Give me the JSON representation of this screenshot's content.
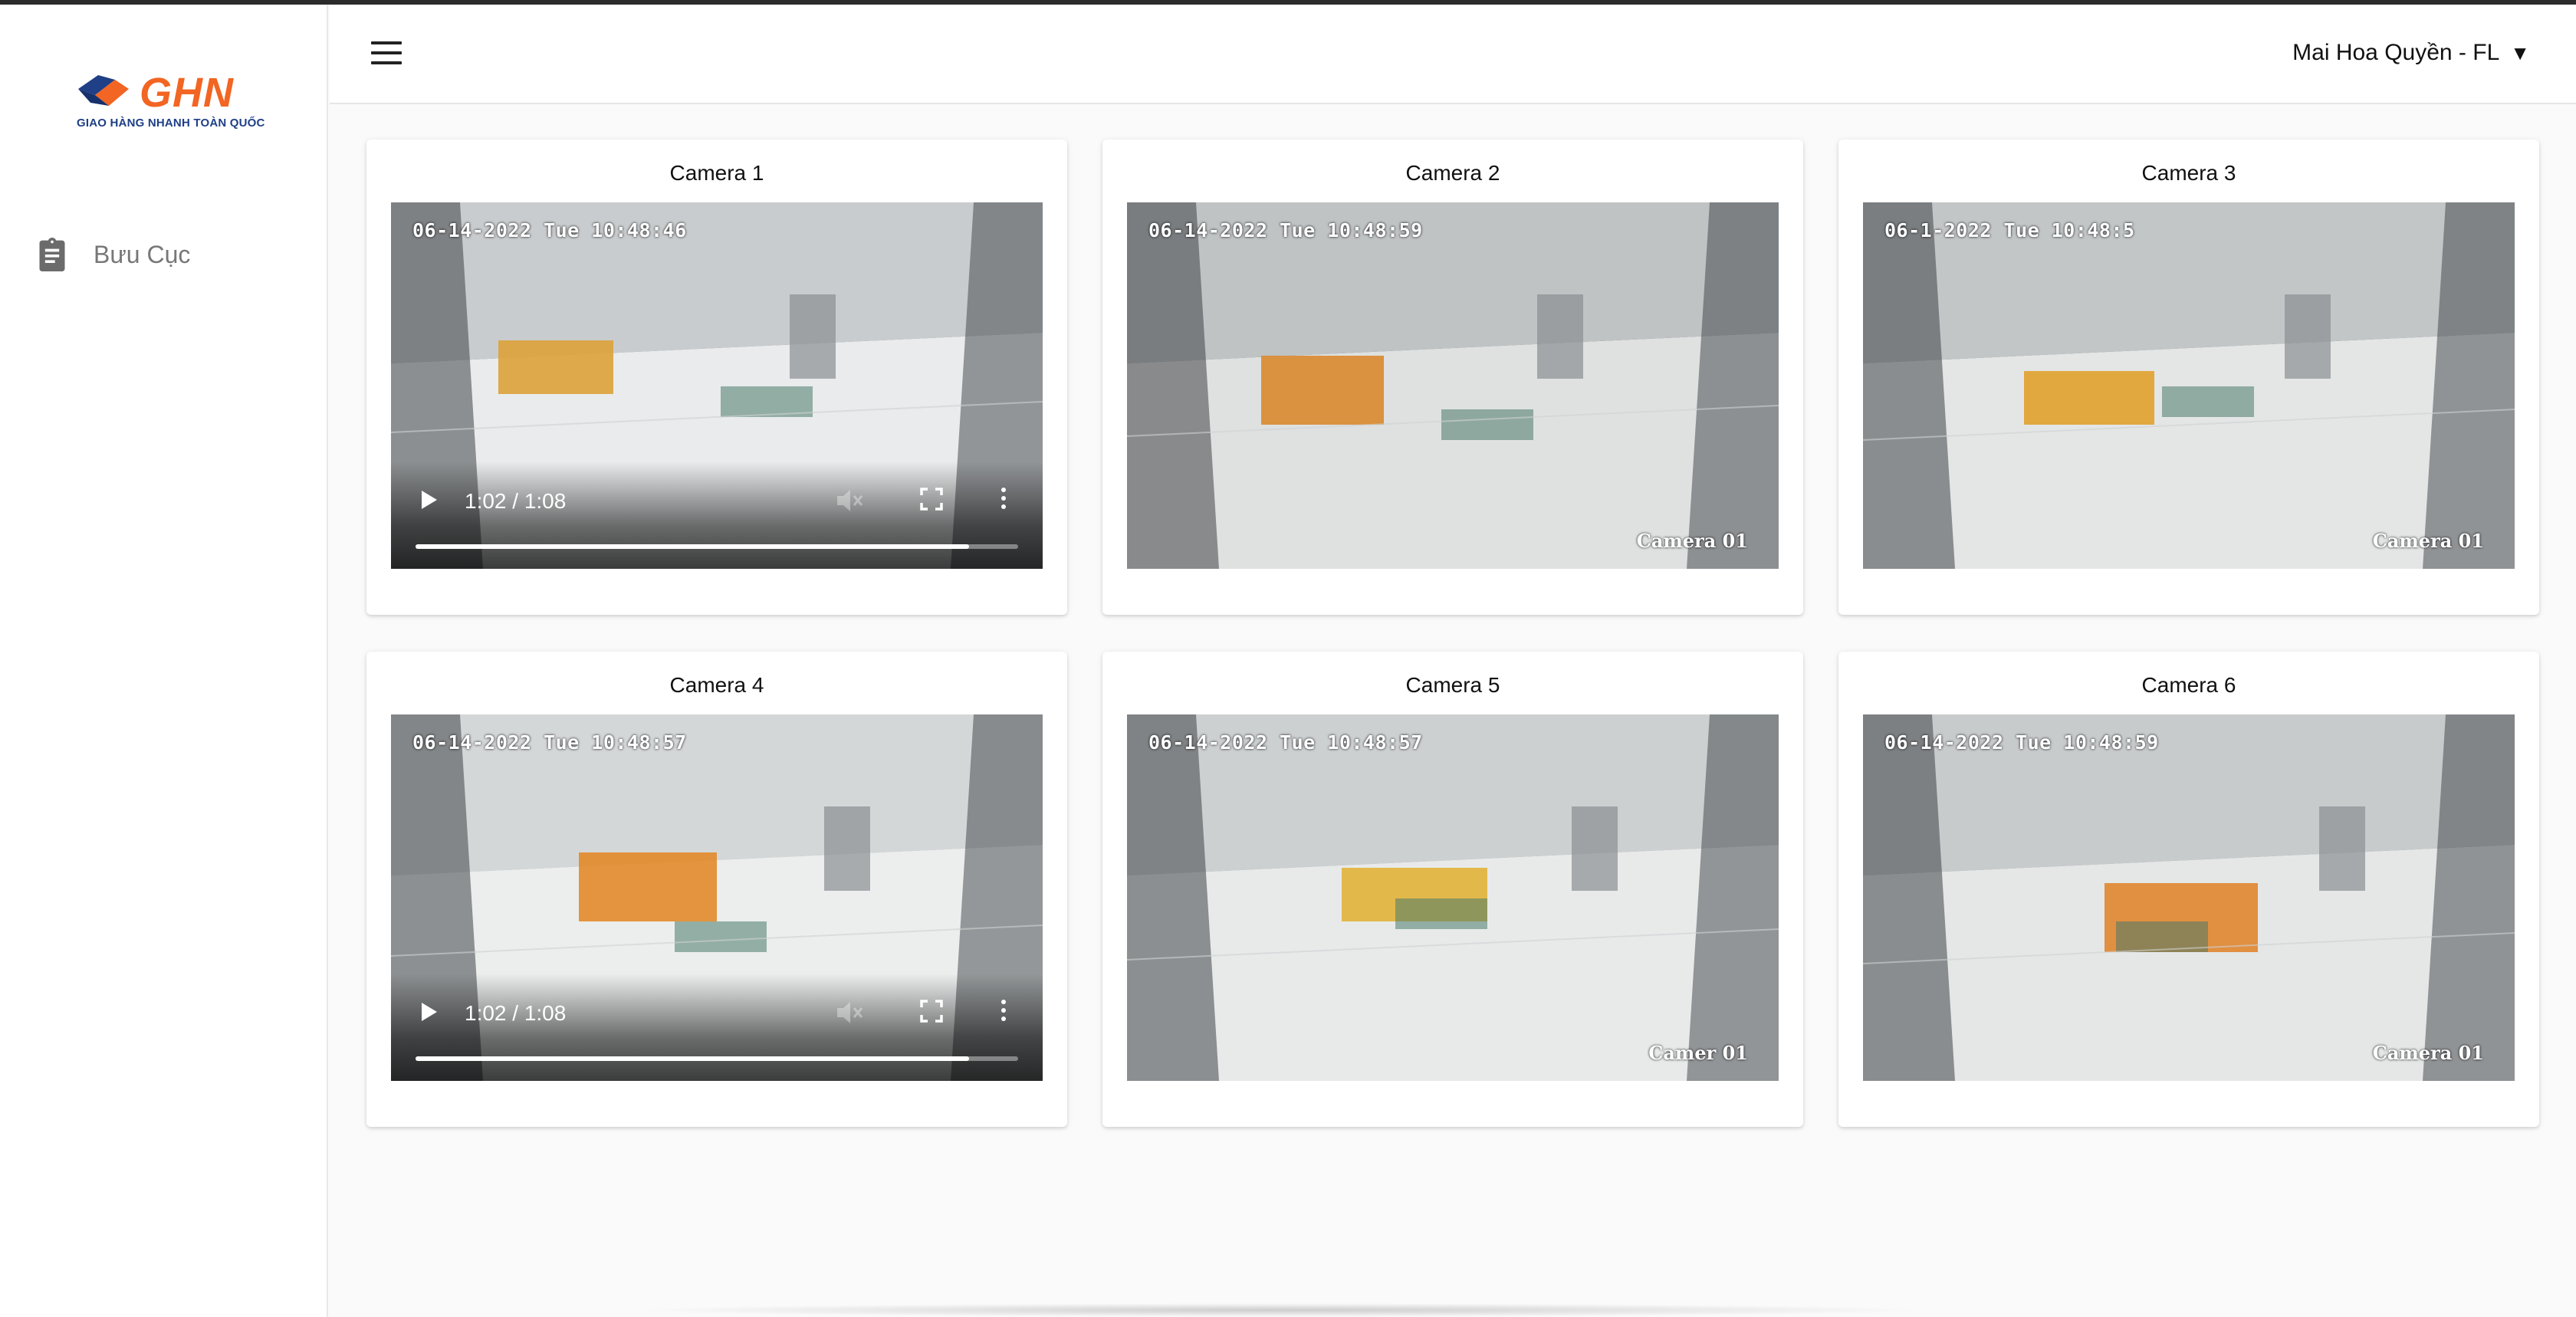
{
  "brand": {
    "name": "GHN",
    "tagline": "GIAO HÀNG NHANH TOÀN QUỐC",
    "colors": {
      "orange": "#f26522",
      "navy": "#1f3f86"
    }
  },
  "sidebar": {
    "items": [
      {
        "label": "Bưu Cục",
        "icon": "clipboard-icon"
      }
    ]
  },
  "header": {
    "menu_icon": "hamburger-menu-icon",
    "user_label": "Mai Hoa Quyền - FL",
    "caret": "▼"
  },
  "cameras": [
    {
      "title": "Camera 1",
      "timestamp": "06-14-2022 Tue 10:48:46",
      "overlay_name": "",
      "has_controls": true,
      "time": "1:02 / 1:08",
      "progress": 0.918
    },
    {
      "title": "Camera 2",
      "timestamp": "06-14-2022 Tue 10:48:59",
      "overlay_name": "Camera 01",
      "has_controls": false
    },
    {
      "title": "Camera 3",
      "timestamp": "06-1-2022 Tue 10:48:5",
      "overlay_name": "Camera 01",
      "has_controls": false
    },
    {
      "title": "Camera 4",
      "timestamp": "06-14-2022 Tue 10:48:57",
      "overlay_name": "",
      "has_controls": true,
      "time": "1:02 / 1:08",
      "progress": 0.918
    },
    {
      "title": "Camera 5",
      "timestamp": "06-14-2022 Tue 10:48:57",
      "overlay_name": "Camer 01",
      "has_controls": false
    },
    {
      "title": "Camera 6",
      "timestamp": "06-14-2022 Tue 10:48:59",
      "overlay_name": "Camera 01",
      "has_controls": false
    }
  ]
}
